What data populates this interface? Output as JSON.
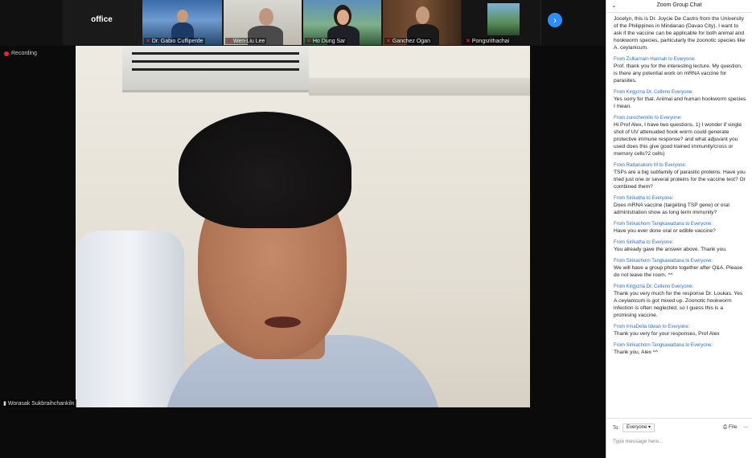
{
  "gallery": {
    "office_label": "office",
    "tiles": [
      {
        "name": "Dr. Gabio Cuffiperde"
      },
      {
        "name": "Wen-Liu Lee"
      },
      {
        "name": "Ho Dung Sar"
      },
      {
        "name": "Ganchez Ogan"
      },
      {
        "name": "Pongsrithachai"
      }
    ],
    "next_icon": "chevron-right-icon"
  },
  "recording": {
    "label": "Recording"
  },
  "main_video": {
    "speaker_name": "Worasak Sukbraihchankiln"
  },
  "chat": {
    "title": "Zoom Group Chat",
    "messages": [
      {
        "from": "",
        "text": "Jocelyn, this is Dr. Joycie De Castro from the University of the Philippines in Mindanao (Davao City). I want to ask if the vaccine can be applicable for both animal and hookworm species, particularly the zoonotic species like A. ceylanicum."
      },
      {
        "from": "From Zulkarnain Hannah to Everyone:",
        "text": "Prof. thank you for the interesting lecture. My question, is there any potential work on mRNA vaccine for parasites."
      },
      {
        "from": "From Kirgyzna Dr. Celleno Everyone:",
        "text": "Yes sorry for that. Animal and human hookworm species I mean."
      },
      {
        "from": "From zorochemilio to Everyone:",
        "text": "Hi Prof Alex, I have two questions. 1) I wonder if single shot of UV attenuated hook worm could generate protective immune response? and what adjuvant you used does this give good trained immunity/cross or memory cells?2 cells)"
      },
      {
        "from": "From Rattanakorn M to Everyone:",
        "text": "TSPs are a big subfamily of parasitic proteins. Have you tried just one or several proteins for the vaccine test? Or combined them?"
      },
      {
        "from": "From Sirikatha to Everyone:",
        "text": "Does mRNA vaccine (targeting TSP gene) or oral administration show as long term immunity?"
      },
      {
        "from": "From Sirikachorn Tangkawattana to Everyone:",
        "text": "Have you ever done oral or edible vaccine?"
      },
      {
        "from": "From Sirikatha to Everyone:",
        "text": "You already gave the answer above. Thank you."
      },
      {
        "from": "From Sirikachorn Tangkawattana to Everyone:",
        "text": "We will have a group photo together after Q&A. Please do not leave the room. ^^"
      },
      {
        "from": "From Kirgyzna Dr. Celleno Everyone:",
        "text": "Thank you very much for the response Dr. Loukas. Yes A.ceylanicum is got mixed up. Zoonotic hookworm infection is often neglected, so I guess this is a promising vaccine."
      },
      {
        "from": "From IrmaDella Idwan to Everyone:",
        "text": "Thank you very for your responses, Prof Alex"
      },
      {
        "from": "From Sirikachorn Tangkawattana to Everyone:",
        "text": "Thank you, Alex ^^"
      }
    ],
    "composer": {
      "to_label": "To:",
      "recipient": "Everyone ▾",
      "file_label": "File",
      "more_label": "...",
      "placeholder": "Type message here..."
    }
  }
}
